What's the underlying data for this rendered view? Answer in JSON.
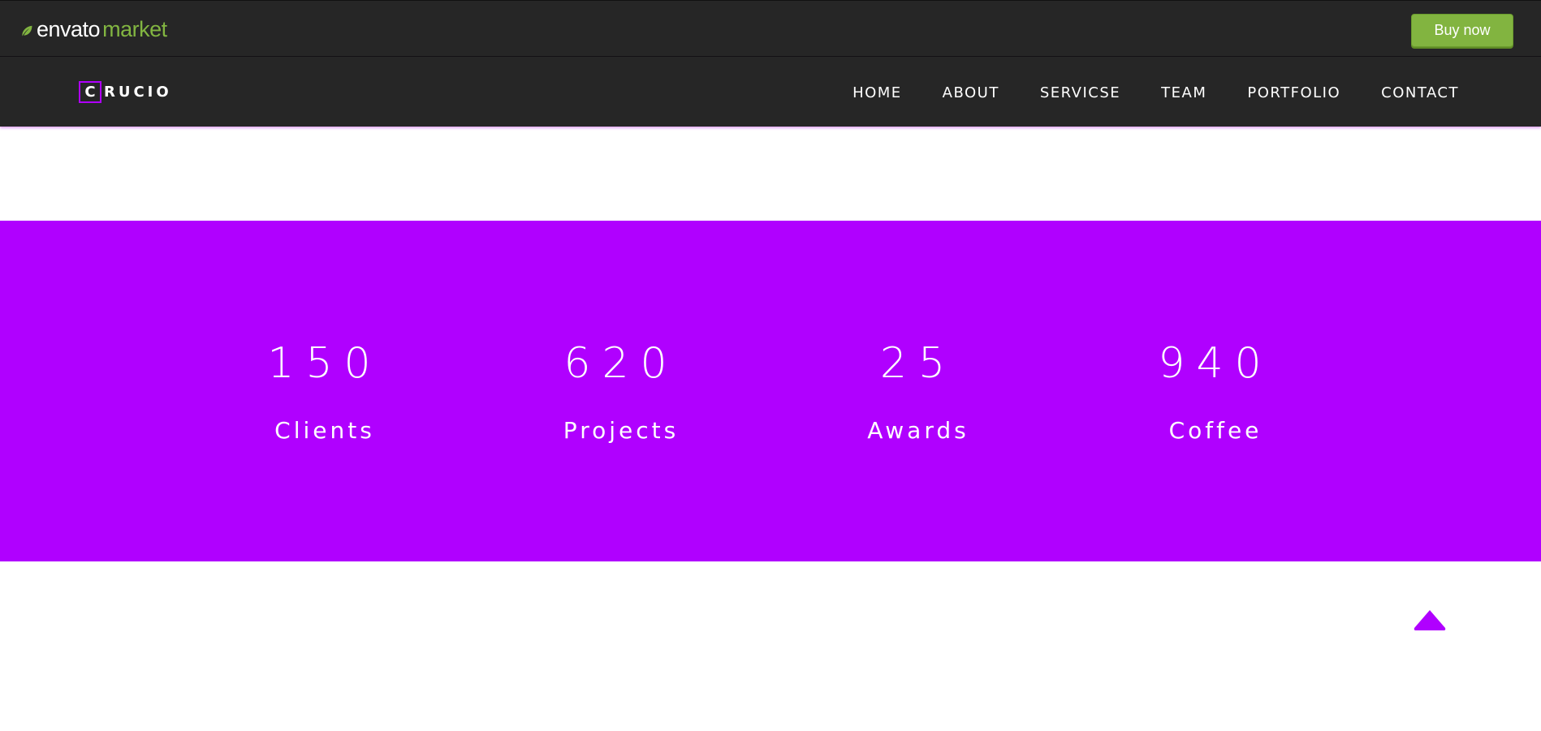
{
  "envato": {
    "brand": "envato",
    "market": "market",
    "buy_label": "Buy now"
  },
  "header": {
    "logo_initial": "C",
    "logo_rest": "RUCIO",
    "nav": [
      "HOME",
      "ABOUT",
      "SERVICSE",
      "TEAM",
      "PORTFOLIO",
      "CONTACT"
    ]
  },
  "counters": [
    {
      "value": "150",
      "label": "Clients"
    },
    {
      "value": "620",
      "label": "Projects"
    },
    {
      "value": "25",
      "label": "Awards"
    },
    {
      "value": "940",
      "label": "Coffee"
    }
  ],
  "scroll_top": {
    "icon": "chevron-up-icon"
  },
  "colors": {
    "accent": "#b000ff",
    "header_bg": "#262626",
    "envato_green": "#82b440"
  }
}
